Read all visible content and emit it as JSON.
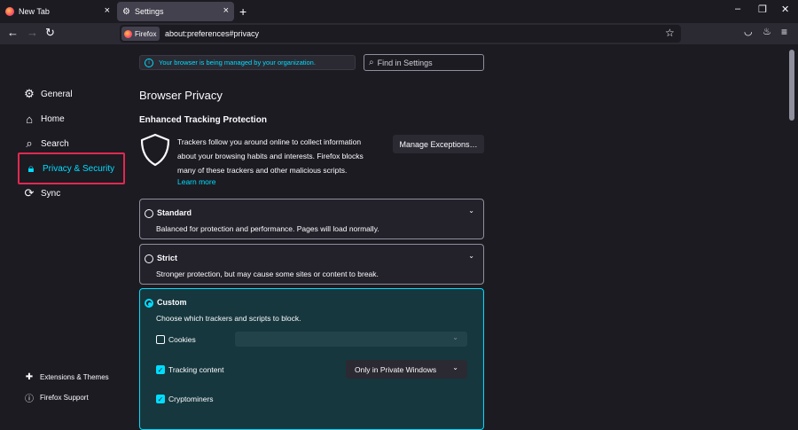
{
  "tabs": [
    {
      "title": "New Tab",
      "close": "×"
    },
    {
      "title": "Settings",
      "close": "×"
    }
  ],
  "new_tab_symbol": "+",
  "window_controls": {
    "minimize": "–",
    "restore": "❐",
    "close": "✕"
  },
  "nav": {
    "identity_label": "Firefox",
    "url": "about:preferences#privacy"
  },
  "sidebar": {
    "items": [
      {
        "label": "General",
        "icon": "gear-icon"
      },
      {
        "label": "Home",
        "icon": "home-icon"
      },
      {
        "label": "Search",
        "icon": "search-icon"
      },
      {
        "label": "Privacy & Security",
        "icon": "lock-icon"
      },
      {
        "label": "Sync",
        "icon": "sync-icon"
      }
    ],
    "footer": [
      {
        "label": "Extensions & Themes",
        "icon": "puzzle-icon"
      },
      {
        "label": "Firefox Support",
        "icon": "help-icon"
      }
    ]
  },
  "banner": {
    "managed_text": "Your browser is being managed by your organization."
  },
  "search": {
    "placeholder": "Find in Settings"
  },
  "privacy": {
    "heading": "Browser Privacy",
    "etp_heading": "Enhanced Tracking Protection",
    "etp_description": "Trackers follow you around online to collect information about your browsing habits and interests. Firefox blocks many of these trackers and other malicious scripts.",
    "learn_more": "Learn more",
    "manage_exceptions": "Manage Exceptions…"
  },
  "options": {
    "standard": {
      "title": "Standard",
      "description": "Balanced for protection and performance. Pages will load normally.",
      "selected": false
    },
    "strict": {
      "title": "Strict",
      "description": "Stronger protection, but may cause some sites or content to break.",
      "selected": false
    },
    "custom": {
      "title": "Custom",
      "description": "Choose which trackers and scripts to block.",
      "selected": true,
      "checkboxes": [
        {
          "label": "Cookies",
          "checked": false
        },
        {
          "label": "Tracking content",
          "checked": true,
          "select_value": "Only in Private Windows"
        },
        {
          "label": "Cryptominers",
          "checked": true
        }
      ]
    }
  },
  "colors": {
    "accent": "#00ddff",
    "highlight_border": "#e22850",
    "background": "#1c1b22"
  }
}
